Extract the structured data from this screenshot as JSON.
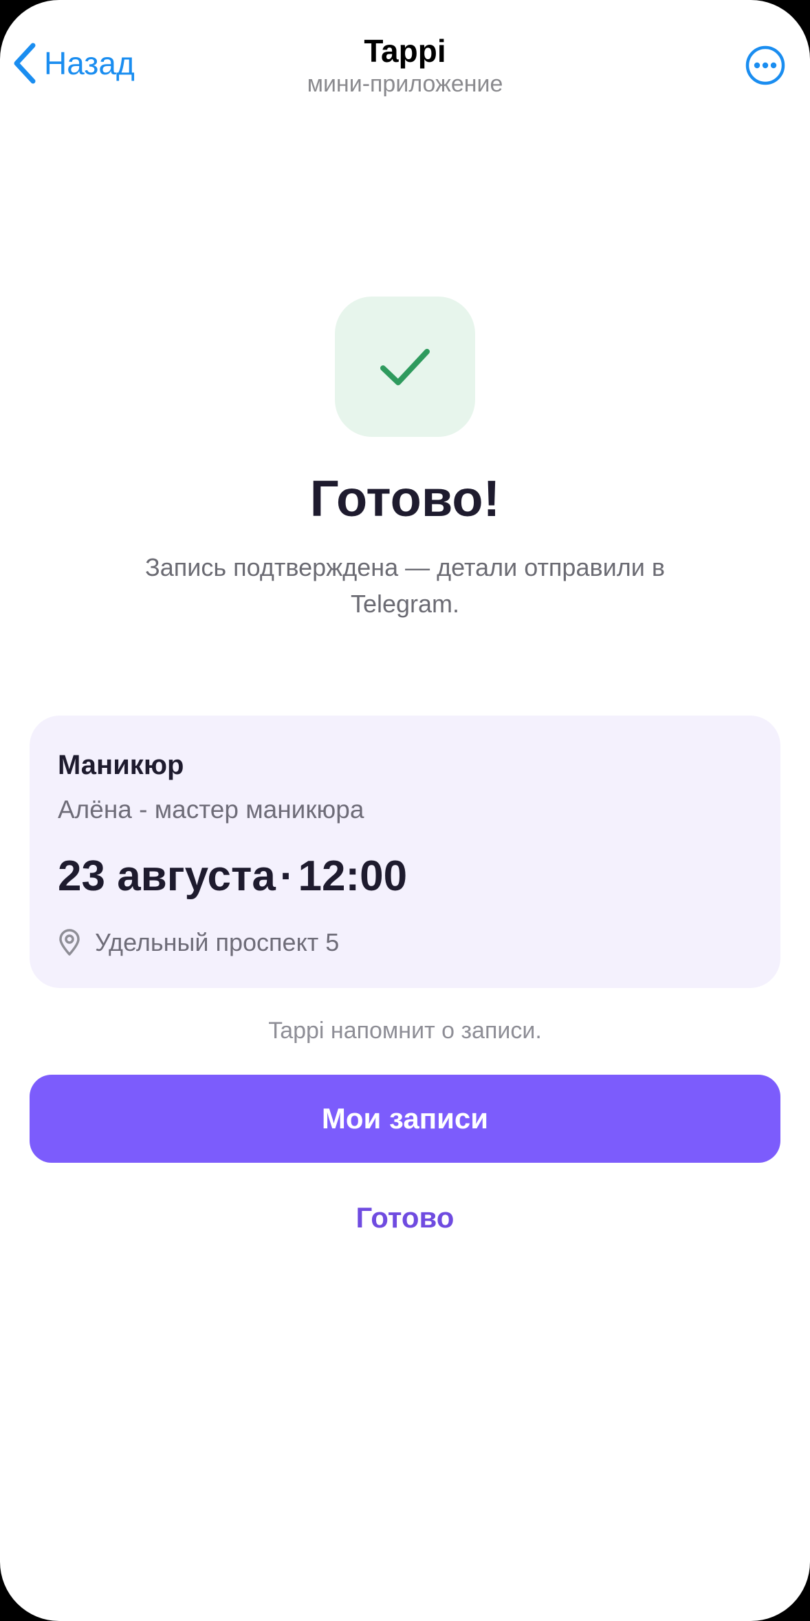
{
  "header": {
    "back_label": "Назад",
    "title": "Tappi",
    "subtitle": "мини-приложение"
  },
  "icons": {
    "back": "chevron-left-icon",
    "more": "more-icon",
    "success": "checkmark-icon",
    "location": "location-pin-icon"
  },
  "success": {
    "title": "Готово!",
    "description": "Запись подтверждена — детали отправили в Telegram."
  },
  "booking": {
    "service": "Маникюр",
    "master": "Алёна - мастер маникюра",
    "date": "23 августа",
    "separator": "·",
    "time": "12:00",
    "address": "Удельный проспект 5"
  },
  "reminder": "Tappi напомнит о записи.",
  "actions": {
    "primary": "Мои записи",
    "secondary": "Готово"
  },
  "colors": {
    "accent": "#7c5cfc",
    "link": "#1a8df0",
    "success": "#2e9a5d",
    "card_bg": "#f4f1fd"
  }
}
